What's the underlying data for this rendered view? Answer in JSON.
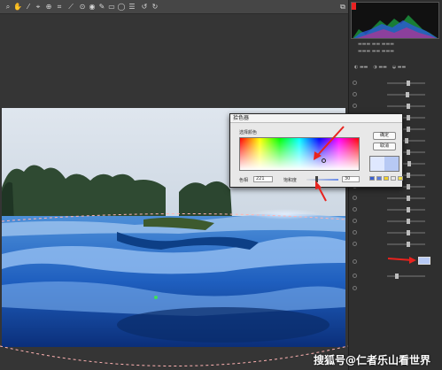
{
  "toolbar": {
    "icons": [
      "zoom-icon",
      "hand-icon",
      "white-balance-icon",
      "color-sampler-icon",
      "target-adjust-icon",
      "crop-icon",
      "straighten-icon",
      "spot-removal-icon",
      "red-eye-icon",
      "adjustment-brush-icon",
      "graduated-filter-icon",
      "radial-filter-icon",
      "preferences-icon",
      "rotate-left-icon",
      "rotate-right-icon",
      "fullscreen-icon"
    ]
  },
  "color_picker": {
    "title": "拾色器",
    "section_label": "选择颜色",
    "ok_label": "确定",
    "cancel_label": "取消",
    "hue_label": "色相",
    "hue_value": "221",
    "saturation_label": "饱和度",
    "saturation_value": "30",
    "preview_old_color": "#dfe8ff",
    "preview_new_color": "#b7c9f4",
    "swatch_colors": [
      "#3a5fd0",
      "#5a7ae0",
      "#f2d12a",
      "#e8e8e8",
      "#f5e24a"
    ]
  },
  "panel": {
    "selected_color": "#b7c9f4"
  },
  "annotation": {
    "arrow_color": "#e8231e"
  },
  "watermark": "搜狐号@仁者乐山看世界"
}
